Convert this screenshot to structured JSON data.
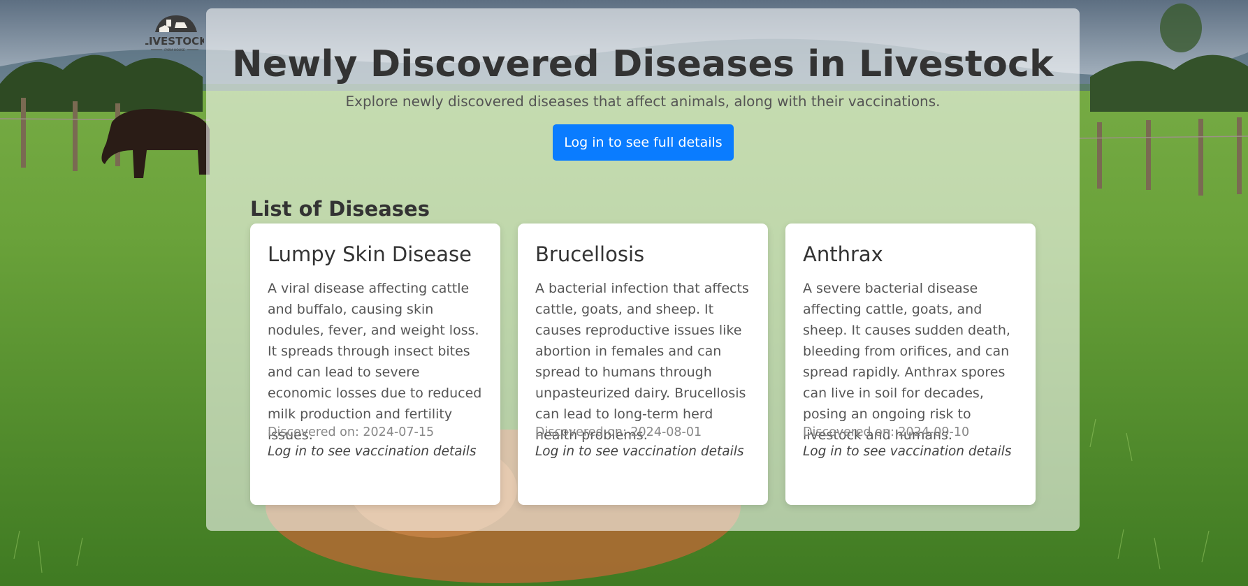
{
  "brand": {
    "logo_text": "LIVESTOCK",
    "logo_subtext": "FARM HOUSE"
  },
  "header": {
    "title": "Newly Discovered Diseases in Livestock",
    "subtitle": "Explore newly discovered diseases that affect animals, along with their vaccinations.",
    "login_button_label": "Log in to see full details"
  },
  "list": {
    "heading": "List of Diseases",
    "diseases": [
      {
        "name": "Lumpy Skin Disease",
        "description": "A viral disease affecting cattle and buffalo, causing skin nodules, fever, and weight loss. It spreads through insect bites and can lead to severe economic losses due to reduced milk production and fertility issues.",
        "discovered": "Discovered on: 2024-07-15",
        "vaccination_note": "Log in to see vaccination details"
      },
      {
        "name": "Brucellosis",
        "description": "A bacterial infection that affects cattle, goats, and sheep. It causes reproductive issues like abortion in females and can spread to humans through unpasteurized dairy. Brucellosis can lead to long-term herd health problems.",
        "discovered": "Discovered on: 2024-08-01",
        "vaccination_note": "Log in to see vaccination details"
      },
      {
        "name": "Anthrax",
        "description": "A severe bacterial disease affecting cattle, goats, and sheep. It causes sudden death, bleeding from orifices, and can spread rapidly. Anthrax spores can live in soil for decades, posing an ongoing risk to livestock and humans.",
        "discovered": "Discovered on: 2024-09-10",
        "vaccination_note": "Log in to see vaccination details"
      }
    ]
  },
  "colors": {
    "primary_button": "#0a7cff",
    "heading_text": "#333333",
    "body_text": "#555555",
    "muted_text": "#888888"
  }
}
